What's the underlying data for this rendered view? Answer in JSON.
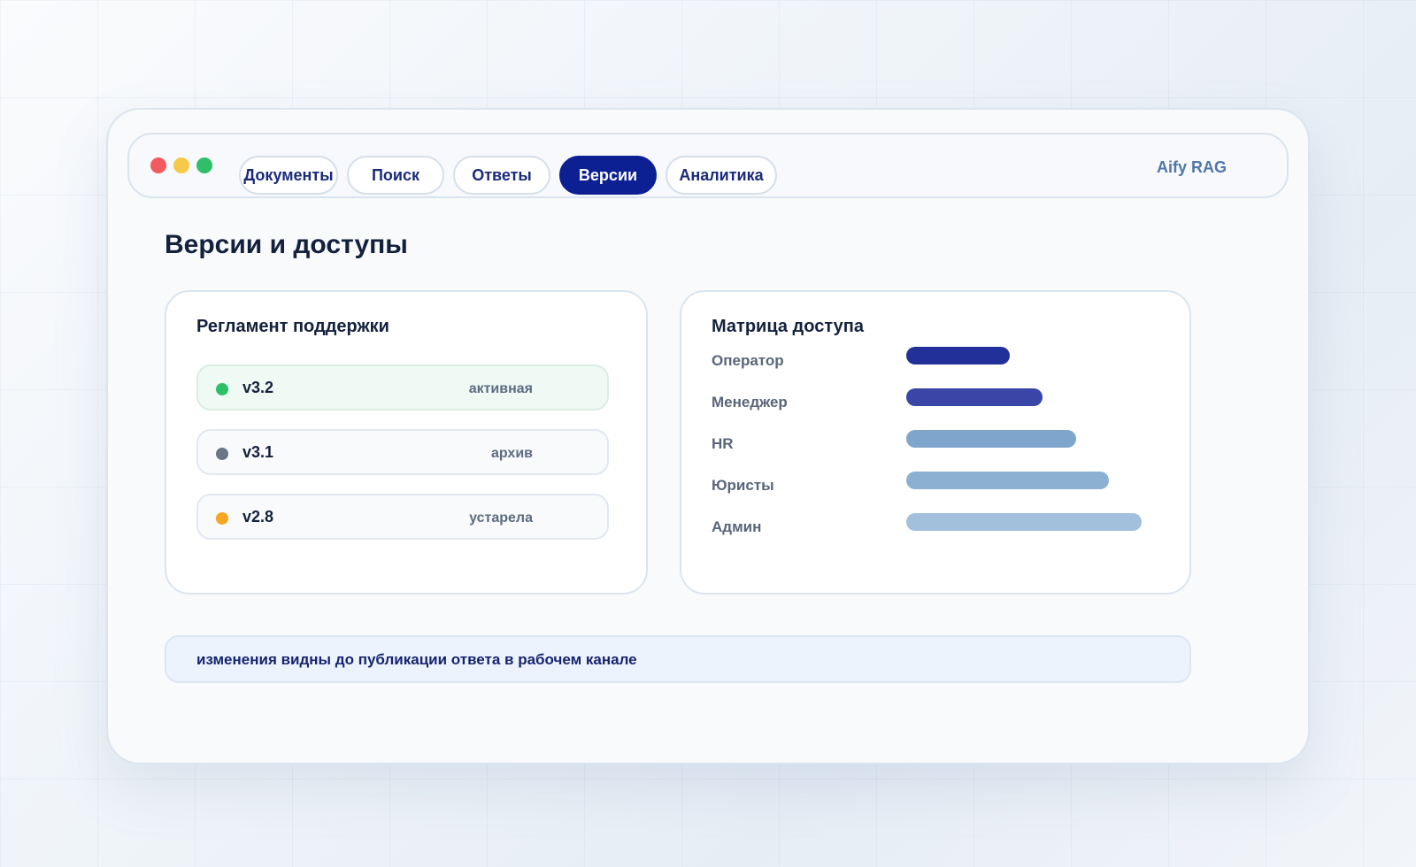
{
  "app": {
    "brand": "Aify RAG"
  },
  "window_controls": [
    {
      "name": "close",
      "color": "#f25a5f"
    },
    {
      "name": "minimize",
      "color": "#f7c948"
    },
    {
      "name": "maximize",
      "color": "#2fbf6b"
    }
  ],
  "tabs": [
    {
      "label": "Документы",
      "active": false
    },
    {
      "label": "Поиск",
      "active": false
    },
    {
      "label": "Ответы",
      "active": false
    },
    {
      "label": "Версии",
      "active": true
    },
    {
      "label": "Аналитика",
      "active": false
    }
  ],
  "page": {
    "title": "Версии и доступы"
  },
  "versions_card": {
    "title": "Регламент поддержки",
    "items": [
      {
        "version": "v3.2",
        "status": "активная",
        "status_color": "#2fbf6b"
      },
      {
        "version": "v3.1",
        "status": "архив",
        "status_color": "#6b7588"
      },
      {
        "version": "v2.8",
        "status": "устарела",
        "status_color": "#f5a623"
      }
    ]
  },
  "access_card": {
    "title": "Матрица доступа",
    "roles": [
      {
        "role": "Оператор",
        "level": 0.44,
        "color": "#22309a"
      },
      {
        "role": "Менеджер",
        "level": 0.58,
        "color": "#3a45a8"
      },
      {
        "role": "HR",
        "level": 0.72,
        "color": "#7ea6cd"
      },
      {
        "role": "Юристы",
        "level": 0.86,
        "color": "#8cb0d2"
      },
      {
        "role": "Админ",
        "level": 1.0,
        "color": "#a2bfdb"
      }
    ]
  },
  "footer_note": {
    "text": "изменения видны до публикации ответа в рабочем канале"
  },
  "colors": {
    "accent": "#0c1f93",
    "brand_text": "#4f77a9"
  }
}
